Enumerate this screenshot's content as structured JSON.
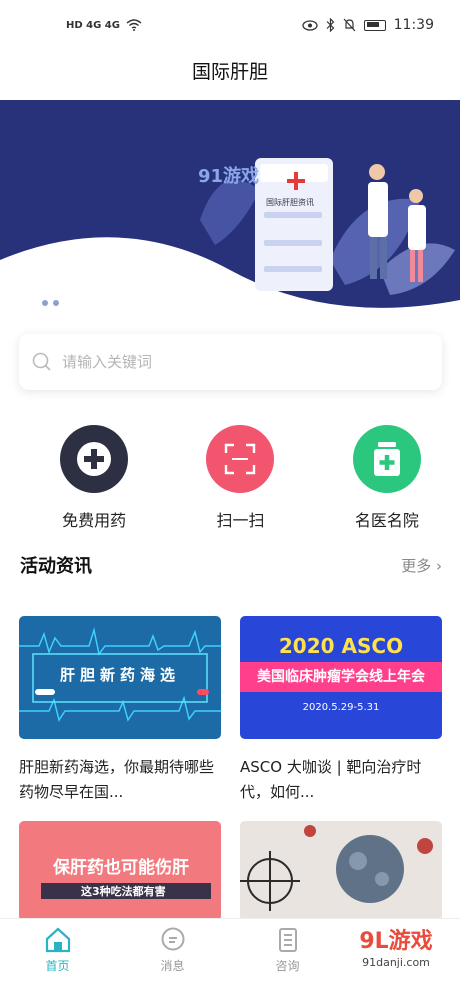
{
  "status_bar": {
    "left_text": "HD 4G 4G",
    "time": "11:39"
  },
  "app": {
    "title": "国际肝胆"
  },
  "banner": {
    "brand_logo": "91游戏",
    "card_title": "国际肝胆资讯",
    "card_logo_text": "国际肝胆资讯",
    "dots": 3,
    "active_dot": 0
  },
  "search": {
    "placeholder": "请输入关键词"
  },
  "actions": [
    {
      "label": "免费用药",
      "icon": "plus-cross-icon",
      "color": "#2c3042"
    },
    {
      "label": "扫一扫",
      "icon": "scan-icon",
      "color": "#f2556e"
    },
    {
      "label": "名医名院",
      "icon": "medicine-kit-icon",
      "color": "#2cc77e"
    }
  ],
  "news_section": {
    "title": "活动资讯",
    "more": "更多",
    "items": [
      {
        "thumb_title": "肝胆新药海选",
        "thumb_sub": "新药海选",
        "caption": "肝胆新药海选，你最期待哪些药物尽早在国..."
      },
      {
        "thumb_title": "2020 ASCO",
        "thumb_sub": "美国临床肿瘤学会线上年会",
        "thumb_date": "2020.5.29-5.31",
        "caption": "ASCO 大咖谈 | 靶向治疗时代，如何..."
      },
      {
        "thumb_title": "保肝药也可能伤肝",
        "thumb_sub": "这3种吃法都有害"
      },
      {
        "thumb_title": ""
      }
    ]
  },
  "tabbar": [
    {
      "label": "首页",
      "active": true
    },
    {
      "label": "消息",
      "active": false
    },
    {
      "label": "咨询",
      "active": false
    }
  ],
  "watermark": {
    "big": "9L游戏",
    "small": "91danji.com"
  }
}
